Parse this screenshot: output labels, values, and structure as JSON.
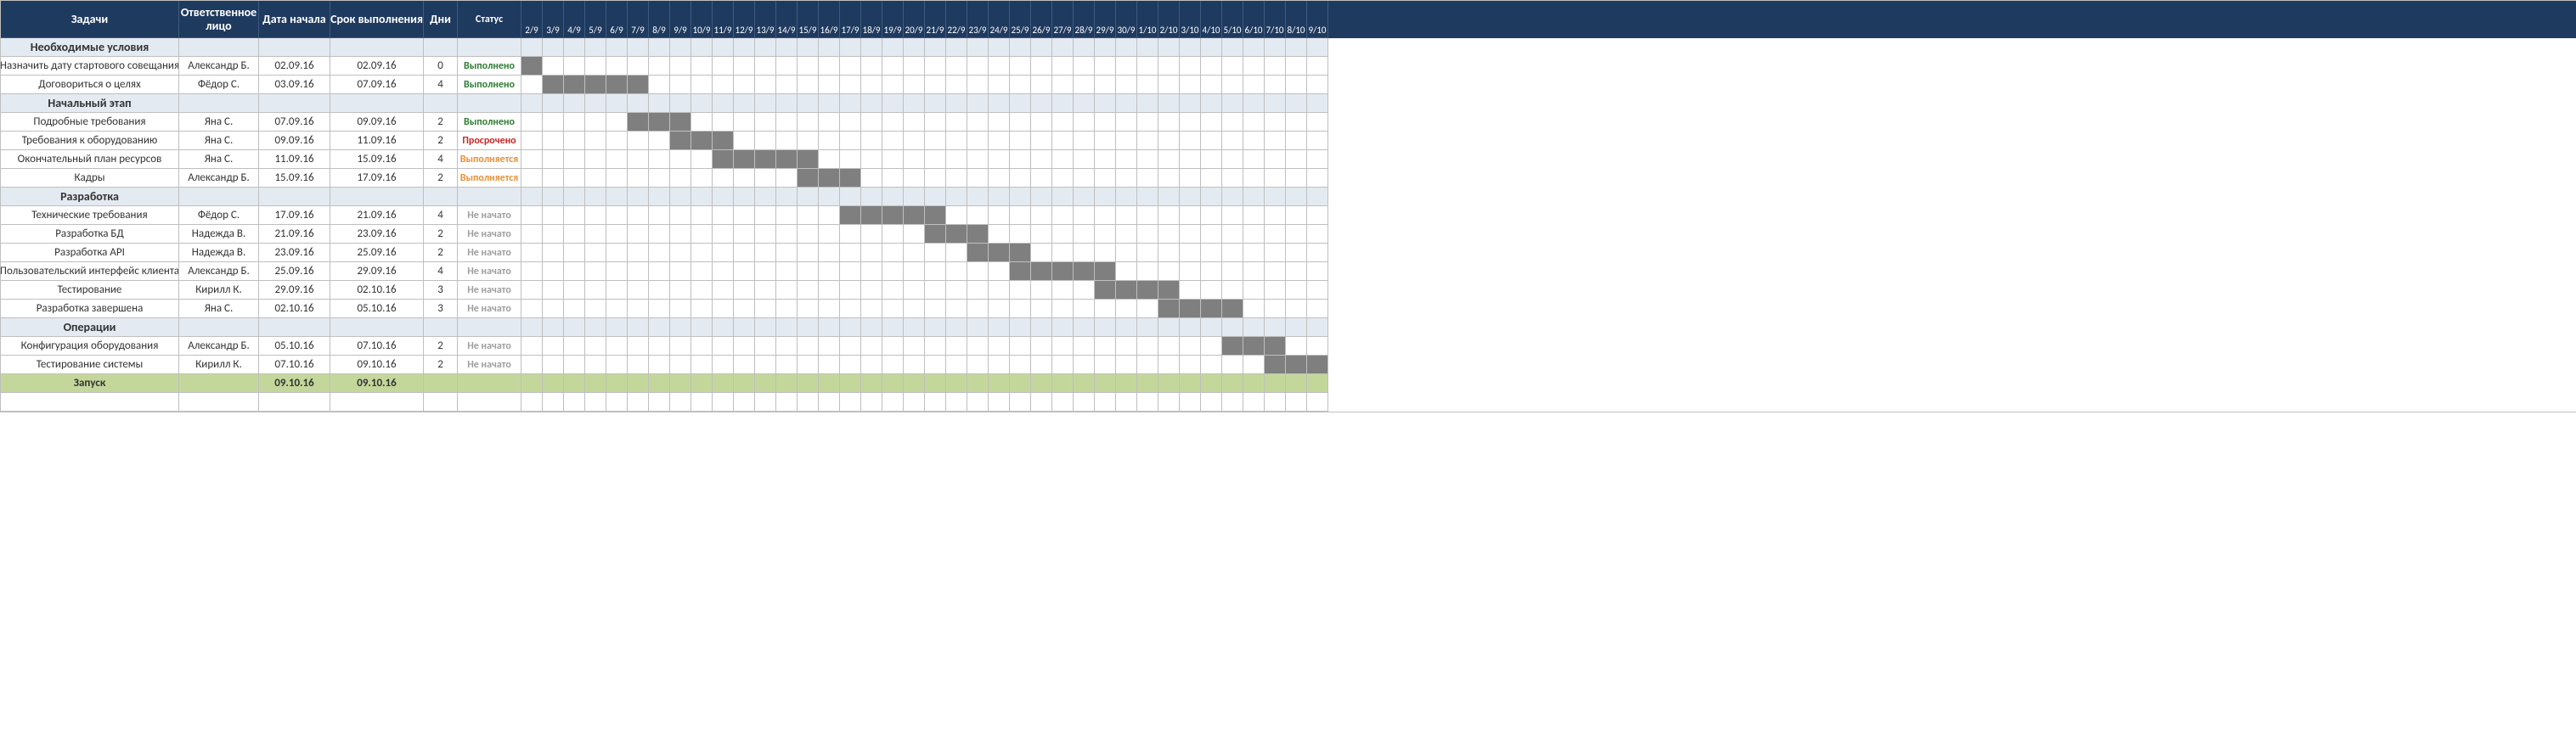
{
  "headers": {
    "task": "Задачи",
    "owner": "Ответственное лицо",
    "start": "Дата начала",
    "due": "Срок выполнения",
    "days": "Дни",
    "status": "Статус"
  },
  "dates": [
    "2/9",
    "3/9",
    "4/9",
    "5/9",
    "6/9",
    "7/9",
    "8/9",
    "9/9",
    "10/9",
    "11/9",
    "12/9",
    "13/9",
    "14/9",
    "15/9",
    "16/9",
    "17/9",
    "18/9",
    "19/9",
    "20/9",
    "21/9",
    "22/9",
    "23/9",
    "24/9",
    "25/9",
    "26/9",
    "27/9",
    "28/9",
    "29/9",
    "30/9",
    "1/10",
    "2/10",
    "3/10",
    "4/10",
    "5/10",
    "6/10",
    "7/10",
    "8/10",
    "9/10"
  ],
  "status_labels": {
    "done": "Выполнено",
    "late": "Просрочено",
    "prog": "Выполняется",
    "nstart": "Не начато"
  },
  "rows": [
    {
      "type": "section",
      "task": "Необходимые условия"
    },
    {
      "type": "task",
      "task": "Назначить дату стартового совещания",
      "owner": "Александр Б.",
      "start": "02.09.16",
      "due": "02.09.16",
      "days": "0",
      "status": "done",
      "bar_from": 0,
      "bar_to": 0
    },
    {
      "type": "task",
      "task": "Договориться о целях",
      "owner": "Фёдор С.",
      "start": "03.09.16",
      "due": "07.09.16",
      "days": "4",
      "status": "done",
      "bar_from": 1,
      "bar_to": 5
    },
    {
      "type": "section",
      "task": "Начальный этап"
    },
    {
      "type": "task",
      "task": "Подробные требования",
      "owner": "Яна С.",
      "start": "07.09.16",
      "due": "09.09.16",
      "days": "2",
      "status": "done",
      "bar_from": 5,
      "bar_to": 7
    },
    {
      "type": "task",
      "task": "Требования к оборудованию",
      "owner": "Яна С.",
      "start": "09.09.16",
      "due": "11.09.16",
      "days": "2",
      "status": "late",
      "bar_from": 7,
      "bar_to": 9
    },
    {
      "type": "task",
      "task": "Окончательный план ресурсов",
      "owner": "Яна С.",
      "start": "11.09.16",
      "due": "15.09.16",
      "days": "4",
      "status": "prog",
      "bar_from": 9,
      "bar_to": 13
    },
    {
      "type": "task",
      "task": "Кадры",
      "owner": "Александр Б.",
      "start": "15.09.16",
      "due": "17.09.16",
      "days": "2",
      "status": "prog",
      "bar_from": 13,
      "bar_to": 15
    },
    {
      "type": "section",
      "task": "Разработка"
    },
    {
      "type": "task",
      "task": "Технические требования",
      "owner": "Фёдор С.",
      "start": "17.09.16",
      "due": "21.09.16",
      "days": "4",
      "status": "nstart",
      "bar_from": 15,
      "bar_to": 19
    },
    {
      "type": "task",
      "task": "Разработка БД",
      "owner": "Надежда В.",
      "start": "21.09.16",
      "due": "23.09.16",
      "days": "2",
      "status": "nstart",
      "bar_from": 19,
      "bar_to": 21
    },
    {
      "type": "task",
      "task": "Разработка API",
      "owner": "Надежда В.",
      "start": "23.09.16",
      "due": "25.09.16",
      "days": "2",
      "status": "nstart",
      "bar_from": 21,
      "bar_to": 23
    },
    {
      "type": "task",
      "task": "Пользовательский интерфейс клиента",
      "owner": "Александр Б.",
      "start": "25.09.16",
      "due": "29.09.16",
      "days": "4",
      "status": "nstart",
      "bar_from": 23,
      "bar_to": 27
    },
    {
      "type": "task",
      "task": "Тестирование",
      "owner": "Кирилл К.",
      "start": "29.09.16",
      "due": "02.10.16",
      "days": "3",
      "status": "nstart",
      "bar_from": 27,
      "bar_to": 30
    },
    {
      "type": "task",
      "task": "Разработка завершена",
      "owner": "Яна С.",
      "start": "02.10.16",
      "due": "05.10.16",
      "days": "3",
      "status": "nstart",
      "bar_from": 30,
      "bar_to": 33
    },
    {
      "type": "section",
      "task": "Операции"
    },
    {
      "type": "task",
      "task": "Конфигурация оборудования",
      "owner": "Александр Б.",
      "start": "05.10.16",
      "due": "07.10.16",
      "days": "2",
      "status": "nstart",
      "bar_from": 33,
      "bar_to": 35
    },
    {
      "type": "task",
      "task": "Тестирование системы",
      "owner": "Кирилл К.",
      "start": "07.10.16",
      "due": "09.10.16",
      "days": "2",
      "status": "nstart",
      "bar_from": 35,
      "bar_to": 37
    },
    {
      "type": "launch",
      "task": "Запуск",
      "start": "09.10.16",
      "due": "09.10.16"
    }
  ],
  "chart_data": {
    "type": "gantt",
    "title": "",
    "timeline_start": "2016-09-02",
    "timeline_end": "2016-10-09",
    "x_labels": [
      "2/9",
      "3/9",
      "4/9",
      "5/9",
      "6/9",
      "7/9",
      "8/9",
      "9/9",
      "10/9",
      "11/9",
      "12/9",
      "13/9",
      "14/9",
      "15/9",
      "16/9",
      "17/9",
      "18/9",
      "19/9",
      "20/9",
      "21/9",
      "22/9",
      "23/9",
      "24/9",
      "25/9",
      "26/9",
      "27/9",
      "28/9",
      "29/9",
      "30/9",
      "1/10",
      "2/10",
      "3/10",
      "4/10",
      "5/10",
      "6/10",
      "7/10",
      "8/10",
      "9/10"
    ],
    "sections": [
      {
        "name": "Необходимые условия",
        "tasks": [
          {
            "name": "Назначить дату стартового совещания",
            "owner": "Александр Б.",
            "start": "2016-09-02",
            "end": "2016-09-02",
            "duration_days": 0,
            "status": "Выполнено"
          },
          {
            "name": "Договориться о целях",
            "owner": "Фёдор С.",
            "start": "2016-09-03",
            "end": "2016-09-07",
            "duration_days": 4,
            "status": "Выполнено"
          }
        ]
      },
      {
        "name": "Начальный этап",
        "tasks": [
          {
            "name": "Подробные требования",
            "owner": "Яна С.",
            "start": "2016-09-07",
            "end": "2016-09-09",
            "duration_days": 2,
            "status": "Выполнено"
          },
          {
            "name": "Требования к оборудованию",
            "owner": "Яна С.",
            "start": "2016-09-09",
            "end": "2016-09-11",
            "duration_days": 2,
            "status": "Просрочено"
          },
          {
            "name": "Окончательный план ресурсов",
            "owner": "Яна С.",
            "start": "2016-09-11",
            "end": "2016-09-15",
            "duration_days": 4,
            "status": "Выполняется"
          },
          {
            "name": "Кадры",
            "owner": "Александр Б.",
            "start": "2016-09-15",
            "end": "2016-09-17",
            "duration_days": 2,
            "status": "Выполняется"
          }
        ]
      },
      {
        "name": "Разработка",
        "tasks": [
          {
            "name": "Технические требования",
            "owner": "Фёдор С.",
            "start": "2016-09-17",
            "end": "2016-09-21",
            "duration_days": 4,
            "status": "Не начато"
          },
          {
            "name": "Разработка БД",
            "owner": "Надежда В.",
            "start": "2016-09-21",
            "end": "2016-09-23",
            "duration_days": 2,
            "status": "Не начато"
          },
          {
            "name": "Разработка API",
            "owner": "Надежда В.",
            "start": "2016-09-23",
            "end": "2016-09-25",
            "duration_days": 2,
            "status": "Не начато"
          },
          {
            "name": "Пользовательский интерфейс клиента",
            "owner": "Александр Б.",
            "start": "2016-09-25",
            "end": "2016-09-29",
            "duration_days": 4,
            "status": "Не начато"
          },
          {
            "name": "Тестирование",
            "owner": "Кирилл К.",
            "start": "2016-09-29",
            "end": "2016-10-02",
            "duration_days": 3,
            "status": "Не начато"
          },
          {
            "name": "Разработка завершена",
            "owner": "Яна С.",
            "start": "2016-10-02",
            "end": "2016-10-05",
            "duration_days": 3,
            "status": "Не начато"
          }
        ]
      },
      {
        "name": "Операции",
        "tasks": [
          {
            "name": "Конфигурация оборудования",
            "owner": "Александр Б.",
            "start": "2016-10-05",
            "end": "2016-10-07",
            "duration_days": 2,
            "status": "Не начато"
          },
          {
            "name": "Тестирование системы",
            "owner": "Кирилл К.",
            "start": "2016-10-07",
            "end": "2016-10-09",
            "duration_days": 2,
            "status": "Не начато"
          }
        ]
      },
      {
        "name": "Запуск",
        "milestone": true,
        "start": "2016-10-09",
        "end": "2016-10-09"
      }
    ]
  }
}
